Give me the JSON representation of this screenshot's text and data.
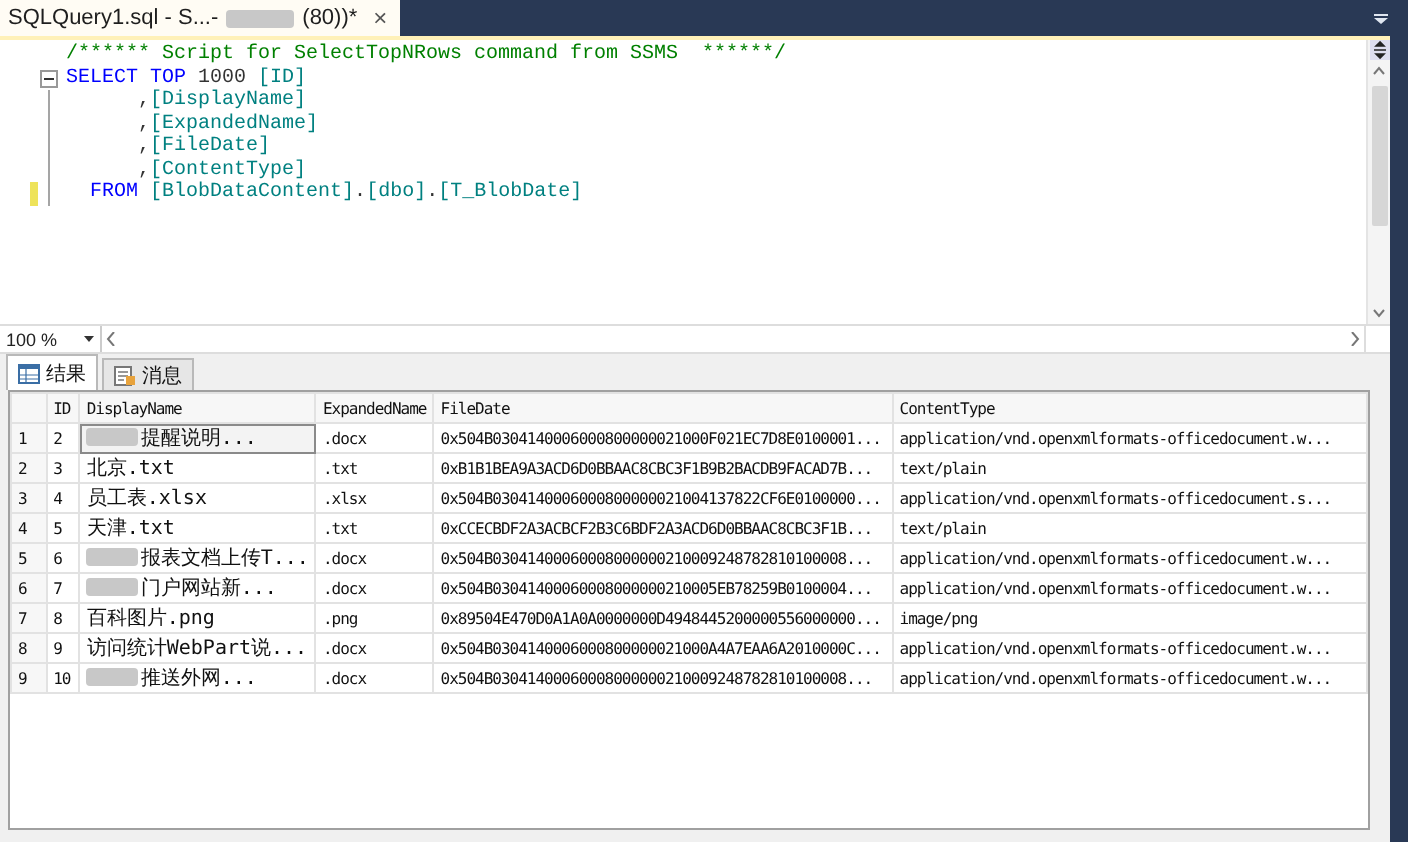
{
  "document_tab": {
    "title_start": "SQLQuery1.sql - S...-",
    "title_end": "(80))*",
    "title_redacted": true,
    "close": "×",
    "selected": true
  },
  "editor": {
    "lines": [
      {
        "kind": "plain",
        "changed": false,
        "tokens": [
          {
            "kind": "comment",
            "text": "/****** Script for SelectTopNRows command from SSMS  ******/"
          }
        ]
      },
      {
        "kind": "fold_start",
        "changed": false,
        "tokens": [
          {
            "kind": "keyword",
            "text": "SELECT TOP"
          },
          {
            "kind": "plain",
            "text": " 1000 "
          },
          {
            "kind": "ident",
            "text": "[ID]"
          }
        ]
      },
      {
        "kind": "fold_body",
        "changed": false,
        "tokens": [
          {
            "kind": "plain",
            "text": "      ,"
          },
          {
            "kind": "ident",
            "text": "[DisplayName]"
          }
        ]
      },
      {
        "kind": "fold_body",
        "changed": false,
        "tokens": [
          {
            "kind": "plain",
            "text": "      ,"
          },
          {
            "kind": "ident",
            "text": "[ExpandedName]"
          }
        ]
      },
      {
        "kind": "fold_body",
        "changed": false,
        "tokens": [
          {
            "kind": "plain",
            "text": "      ,"
          },
          {
            "kind": "ident",
            "text": "[FileDate]"
          }
        ]
      },
      {
        "kind": "fold_body",
        "changed": false,
        "tokens": [
          {
            "kind": "plain",
            "text": "      ,"
          },
          {
            "kind": "ident",
            "text": "[ContentType]"
          }
        ]
      },
      {
        "kind": "fold_end",
        "changed": true,
        "tokens": [
          {
            "kind": "keyword",
            "text": "  FROM "
          },
          {
            "kind": "ident",
            "text": "[BlobDataContent]"
          },
          {
            "kind": "plain",
            "text": "."
          },
          {
            "kind": "ident",
            "text": "[dbo]"
          },
          {
            "kind": "plain",
            "text": "."
          },
          {
            "kind": "ident",
            "text": "[T_BlobDate]"
          }
        ]
      }
    ]
  },
  "zoom": {
    "value": "100 %"
  },
  "result_tabs": [
    {
      "label": "结果",
      "kind": "grid",
      "selected": true
    },
    {
      "label": "消息",
      "kind": "messages",
      "selected": false
    }
  ],
  "grid": {
    "columns": [
      "ID",
      "DisplayName",
      "ExpandedName",
      "FileDate",
      "ContentType"
    ],
    "rows": [
      {
        "row_number": "1",
        "id": "2",
        "display_name": {
          "text": "提醒说明...",
          "redacted": true,
          "selected": true
        },
        "expanded_name": ".docx",
        "file_date": "0x504B0304140006000800000021000F021EC7D8E0100001...",
        "content_type": "application/vnd.openxmlformats-officedocument.w..."
      },
      {
        "row_number": "2",
        "id": "3",
        "display_name": {
          "text": "北京.txt",
          "redacted": false,
          "selected": false
        },
        "expanded_name": ".txt",
        "file_date": "0xB1B1BEA9A3ACD6D0BBAAC8CBC3F1B9B2BACDB9FACAD7B...",
        "content_type": "text/plain"
      },
      {
        "row_number": "3",
        "id": "4",
        "display_name": {
          "text": "员工表.xlsx",
          "redacted": false,
          "selected": false
        },
        "expanded_name": ".xlsx",
        "file_date": "0x504B0304140006000800000021004137822CF6E0100000...",
        "content_type": "application/vnd.openxmlformats-officedocument.s..."
      },
      {
        "row_number": "4",
        "id": "5",
        "display_name": {
          "text": "天津.txt",
          "redacted": false,
          "selected": false
        },
        "expanded_name": ".txt",
        "file_date": "0xCCECBDF2A3ACBCF2B3C6BDF2A3ACD6D0BBAAC8CBC3F1B...",
        "content_type": "text/plain"
      },
      {
        "row_number": "5",
        "id": "6",
        "display_name": {
          "text": "报表文档上传T...",
          "redacted": true,
          "selected": false
        },
        "expanded_name": ".docx",
        "file_date": "0x504B03041400060008000000210009248782810100008...",
        "content_type": "application/vnd.openxmlformats-officedocument.w..."
      },
      {
        "row_number": "6",
        "id": "7",
        "display_name": {
          "text": "门户网站新...",
          "redacted": true,
          "selected": false
        },
        "expanded_name": ".docx",
        "file_date": "0x504B03041400060008000000210005EB78259B0100004...",
        "content_type": "application/vnd.openxmlformats-officedocument.w..."
      },
      {
        "row_number": "7",
        "id": "8",
        "display_name": {
          "text": "百科图片.png",
          "redacted": false,
          "selected": false
        },
        "expanded_name": ".png",
        "file_date": "0x89504E470D0A1A0A0000000D4948445200000556000000...",
        "content_type": "image/png"
      },
      {
        "row_number": "8",
        "id": "9",
        "display_name": {
          "text": "访问统计WebPart说...",
          "redacted": false,
          "selected": false
        },
        "expanded_name": ".docx",
        "file_date": "0x504B0304140006000800000021000A4A7EAA6A2010000C...",
        "content_type": "application/vnd.openxmlformats-officedocument.w..."
      },
      {
        "row_number": "9",
        "id": "10",
        "display_name": {
          "text": "推送外网...",
          "redacted": true,
          "selected": false
        },
        "expanded_name": ".docx",
        "file_date": "0x504B03041400060008000000210009248782810100008...",
        "content_type": "application/vnd.openxmlformats-officedocument.w..."
      }
    ]
  }
}
